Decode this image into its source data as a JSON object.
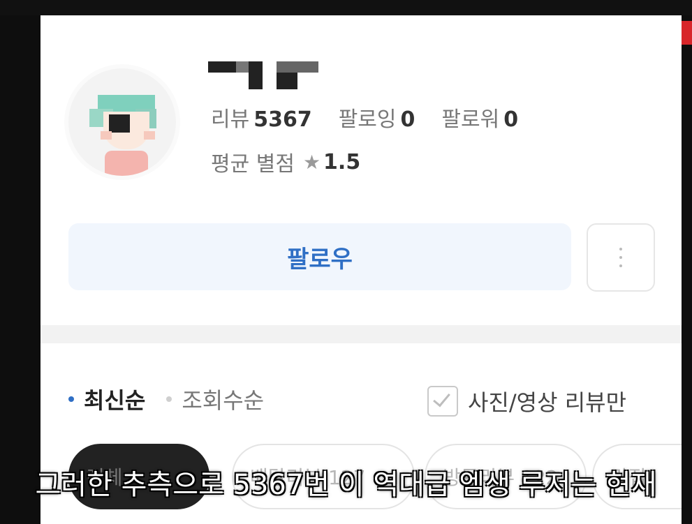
{
  "profile": {
    "stats": [
      {
        "label": "리뷰",
        "value": "5367"
      },
      {
        "label": "팔로잉",
        "value": "0"
      },
      {
        "label": "팔로워",
        "value": "0"
      }
    ],
    "rating_label": "평균 별점",
    "rating_value": "1.5",
    "star_icon": "star-icon"
  },
  "actions": {
    "follow_label": "팔로우",
    "more_icon": "more-vertical-icon"
  },
  "sort": {
    "active_label": "최신순",
    "inactive_label": "조회수순",
    "photo_filter_label": "사진/영상 리뷰만"
  },
  "chips": [
    "전체",
    "배달리뷰 127",
    "방문리뷰 122",
    "맛집"
  ],
  "subtitle": "그러한 추측으로 5367번 이 역대급 엠생 루저는 현재",
  "colors": {
    "accent": "#2f6fc5",
    "follow_bg": "#f1f6fd"
  }
}
